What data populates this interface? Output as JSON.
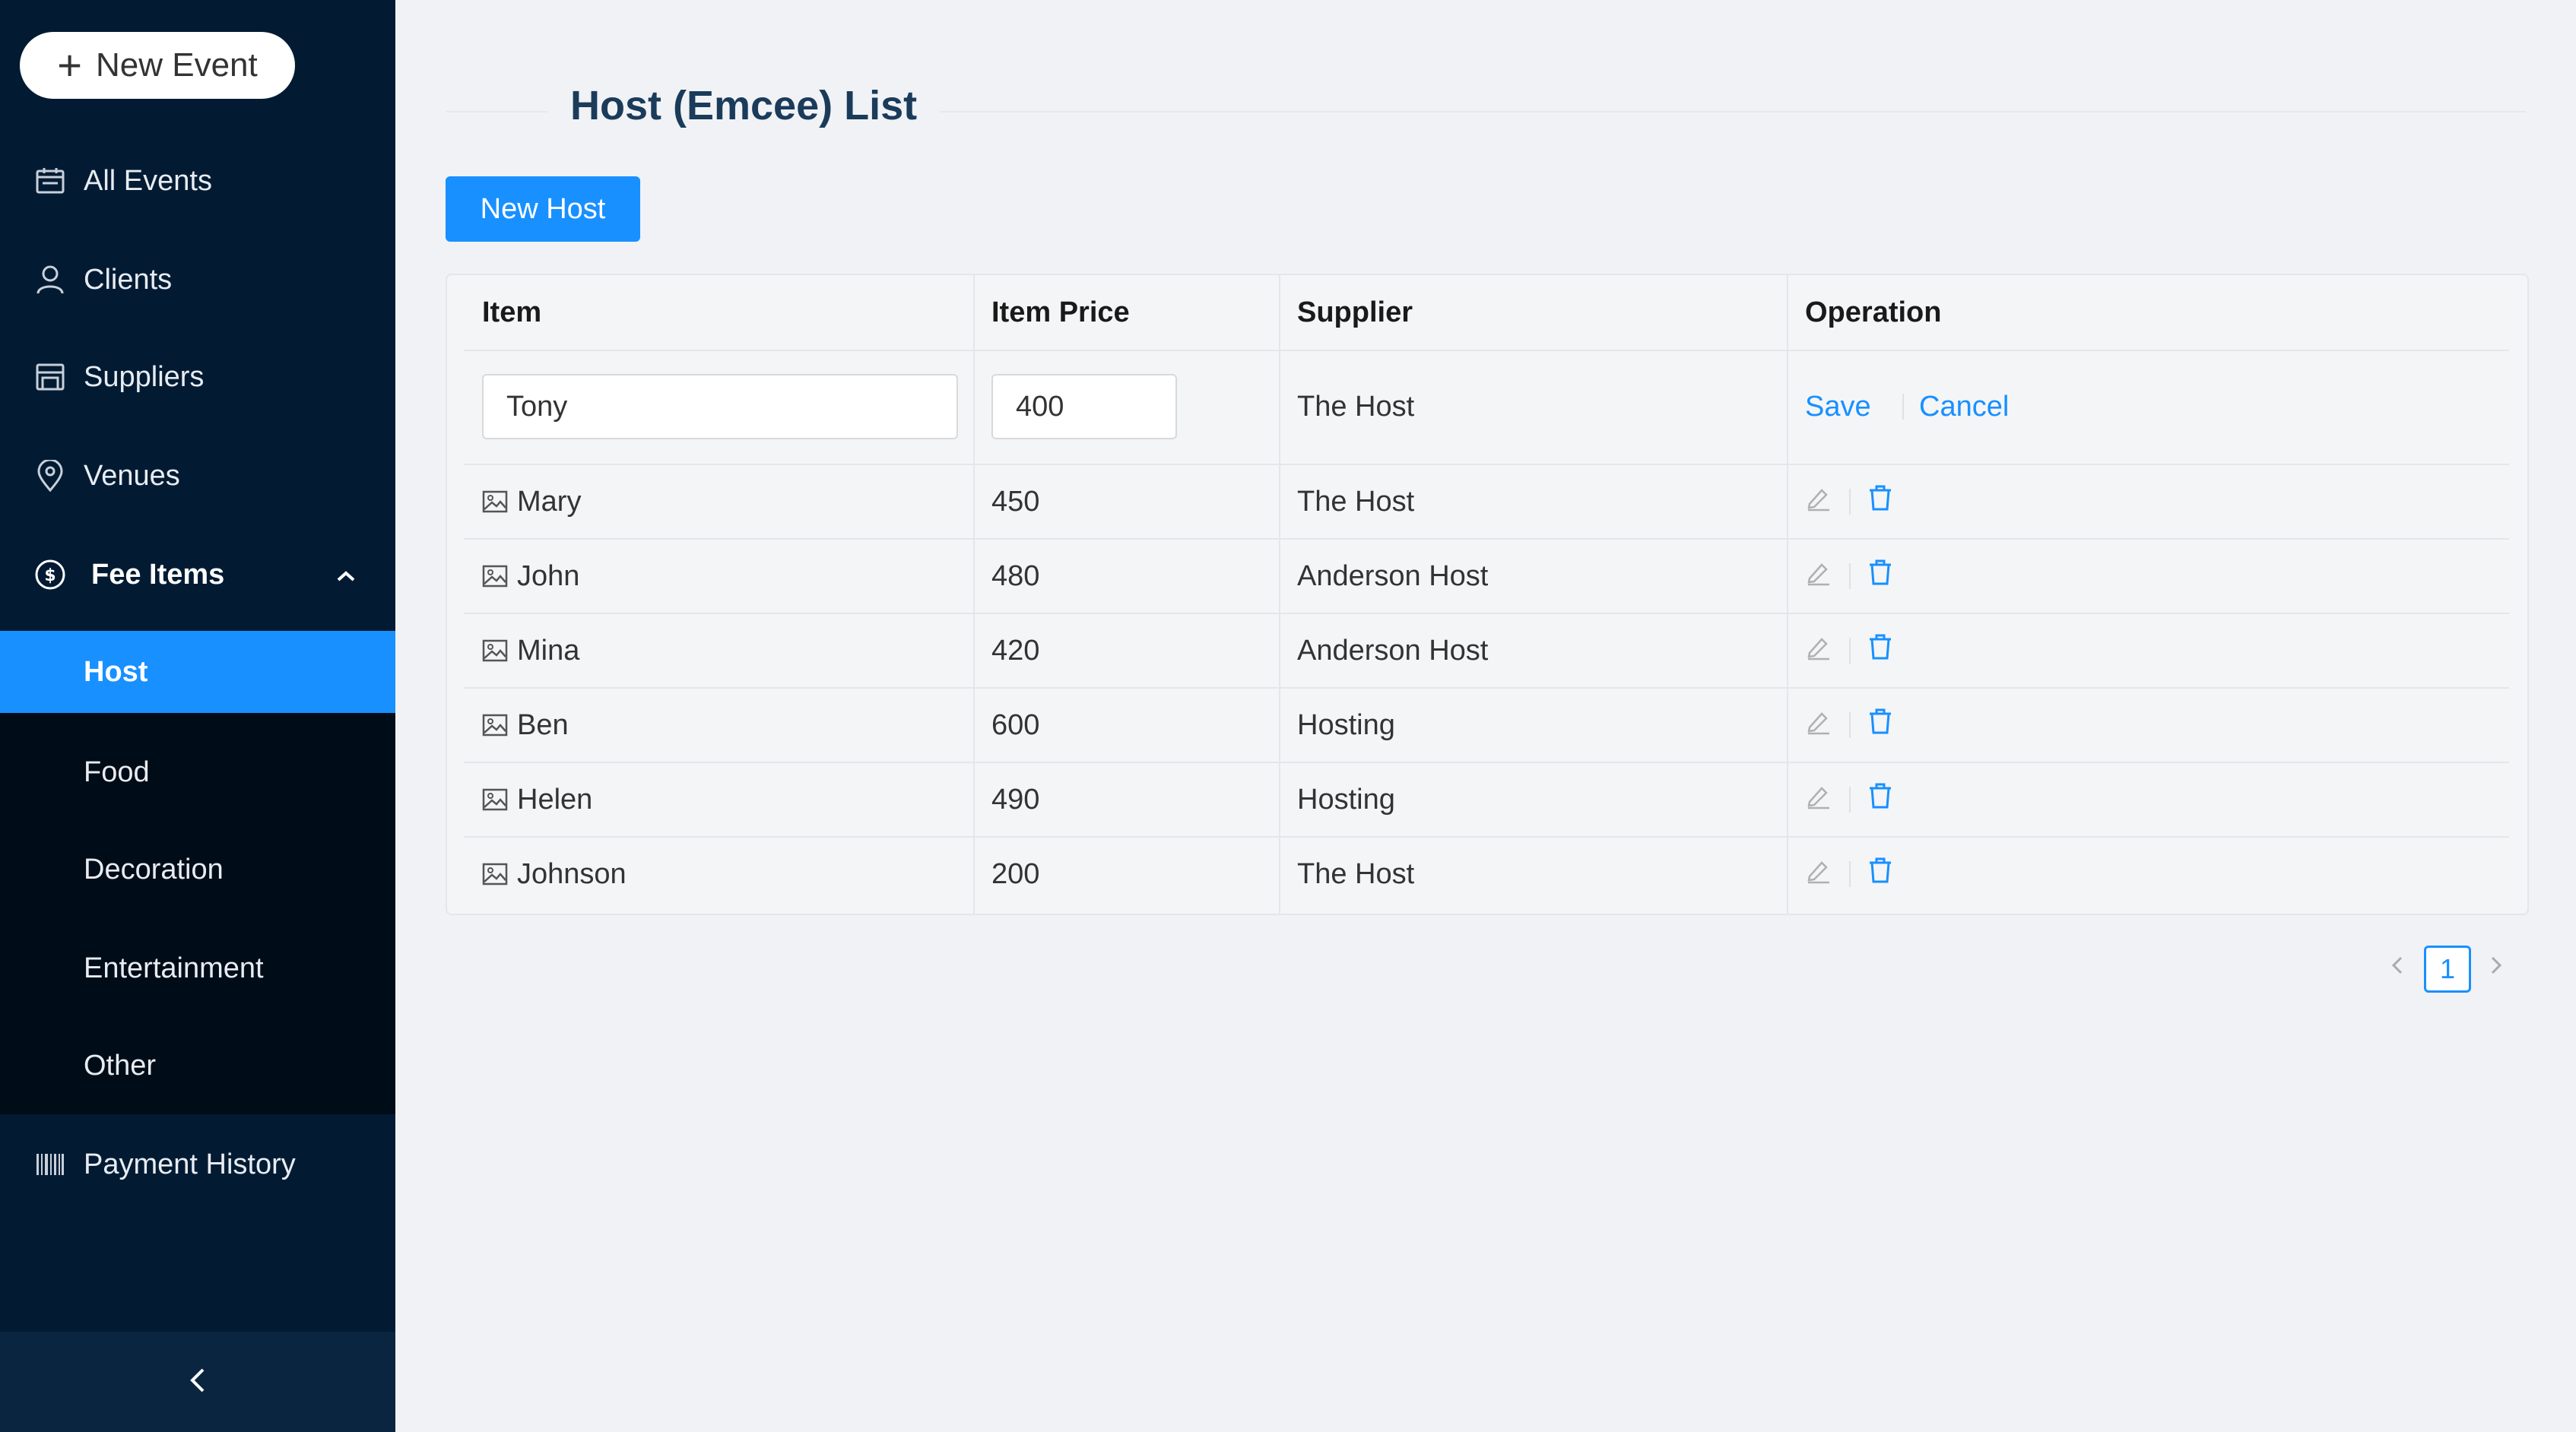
{
  "sidebar": {
    "new_event_label": "New Event",
    "items": [
      {
        "label": "All Events",
        "icon": "calendar-icon"
      },
      {
        "label": "Clients",
        "icon": "user-icon"
      },
      {
        "label": "Suppliers",
        "icon": "store-icon"
      },
      {
        "label": "Venues",
        "icon": "location-icon"
      },
      {
        "label": "Fee Items",
        "icon": "dollar-icon"
      },
      {
        "label": "Payment History",
        "icon": "barcode-icon"
      }
    ],
    "sub_items": [
      "Host",
      "Food",
      "Decoration",
      "Entertainment",
      "Other"
    ],
    "active_sub_item": "Host",
    "collapse_icon": "chevron-left-icon"
  },
  "main": {
    "page_title": "Host (Emcee) List",
    "new_host_label": "New Host",
    "table": {
      "headers": [
        "Item",
        "Item Price",
        "Supplier",
        "Operation"
      ],
      "edit_row": {
        "item_value": "Tony",
        "price_value": "400",
        "supplier": "The Host",
        "save_label": "Save",
        "cancel_label": "Cancel"
      },
      "rows": [
        {
          "item": "Mary",
          "price": "450",
          "supplier": "The Host"
        },
        {
          "item": "John",
          "price": "480",
          "supplier": "Anderson Host"
        },
        {
          "item": "Mina",
          "price": "420",
          "supplier": "Anderson Host"
        },
        {
          "item": "Ben",
          "price": "600",
          "supplier": "Hosting"
        },
        {
          "item": "Helen",
          "price": "490",
          "supplier": "Hosting"
        },
        {
          "item": "Johnson",
          "price": "200",
          "supplier": "The Host"
        }
      ]
    },
    "pagination": {
      "current_page": "1"
    }
  },
  "colors": {
    "sidebar_bg": "#021b33",
    "accent": "#1890ff",
    "page_bg": "#f0f2f5"
  }
}
